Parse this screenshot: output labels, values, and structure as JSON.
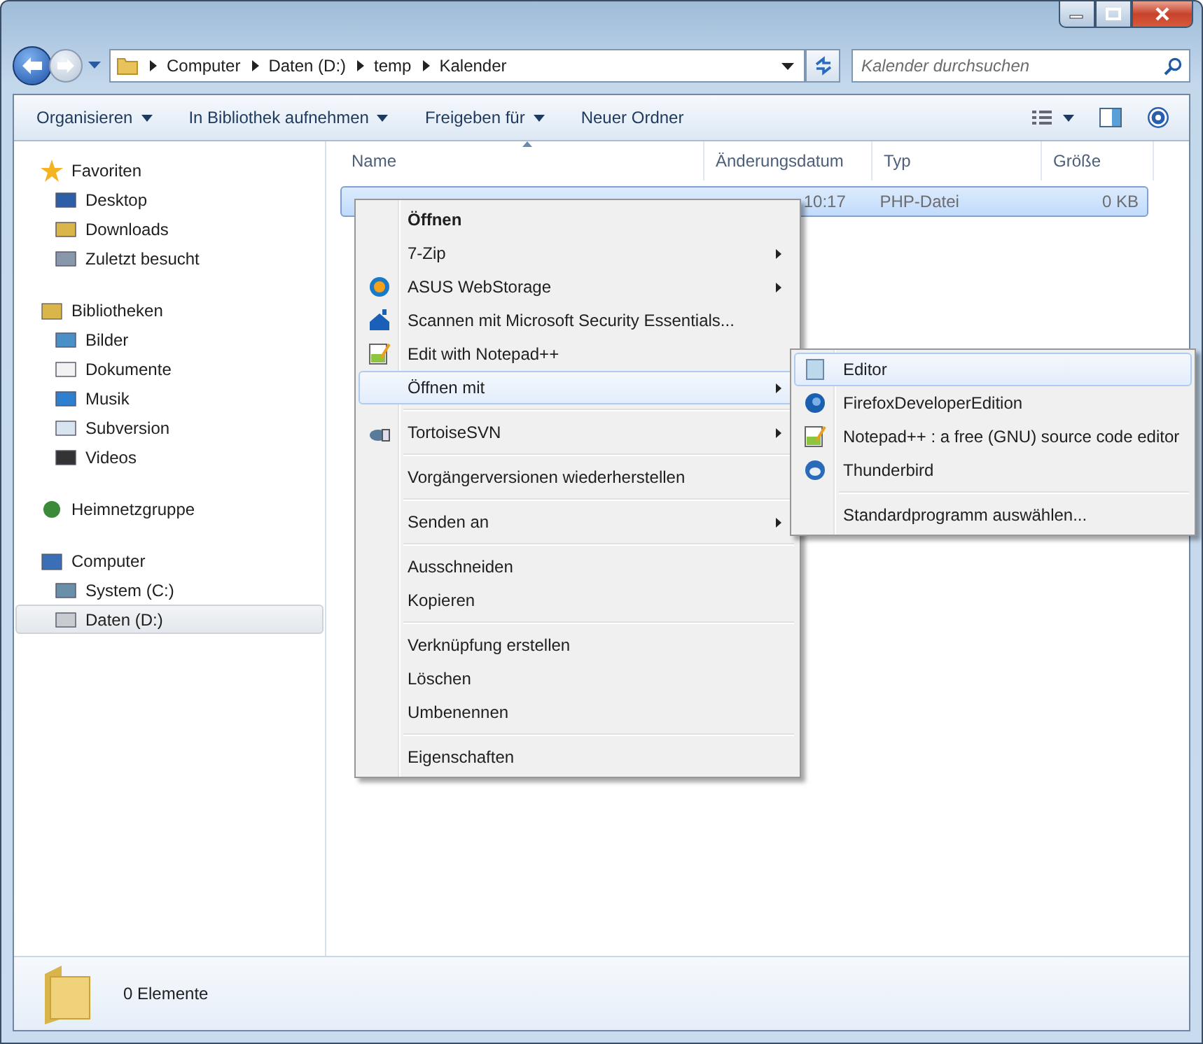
{
  "address_bar": {
    "path": [
      "Computer",
      "Daten (D:)",
      "temp",
      "Kalender"
    ]
  },
  "search": {
    "placeholder": "Kalender durchsuchen"
  },
  "toolbar": [
    {
      "label": "Organisieren",
      "has_menu": true
    },
    {
      "label": "In Bibliothek aufnehmen",
      "has_menu": true
    },
    {
      "label": "Freigeben für",
      "has_menu": true
    },
    {
      "label": "Neuer Ordner",
      "has_menu": false
    }
  ],
  "sidebar": [
    {
      "label": "Favoriten",
      "children": [
        {
          "label": "Desktop",
          "selected": false
        },
        {
          "label": "Downloads",
          "selected": false
        },
        {
          "label": "Zuletzt besucht",
          "selected": false
        }
      ]
    },
    {
      "label": "Bibliotheken",
      "children": [
        {
          "label": "Bilder",
          "selected": false
        },
        {
          "label": "Dokumente",
          "selected": false
        },
        {
          "label": "Musik",
          "selected": false
        },
        {
          "label": "Subversion",
          "selected": false
        },
        {
          "label": "Videos",
          "selected": false
        }
      ]
    },
    {
      "label": "Heimnetzgruppe"
    },
    {
      "label": "Computer",
      "children": [
        {
          "label": "System (C:)",
          "selected": false
        },
        {
          "label": "Daten (D:)",
          "selected": true
        }
      ]
    }
  ],
  "columns": [
    {
      "label": "Name",
      "sorted": true
    },
    {
      "label": "Änderungsdatum",
      "sorted": false
    },
    {
      "label": "Typ",
      "sorted": false
    },
    {
      "label": "Größe",
      "sorted": false
    }
  ],
  "rows": [
    {
      "date": "10:17",
      "type": "PHP-Datei",
      "size": "0 KB",
      "selected": true
    }
  ],
  "context_menu": [
    {
      "kind": "item",
      "label": "Öffnen",
      "default": true,
      "submenu": false,
      "selected": false
    },
    {
      "kind": "item",
      "label": "7-Zip",
      "default": false,
      "submenu": true,
      "selected": false
    },
    {
      "kind": "item",
      "label": "ASUS WebStorage",
      "default": false,
      "submenu": true,
      "selected": false
    },
    {
      "kind": "item",
      "label": "Scannen mit Microsoft Security Essentials...",
      "default": false,
      "submenu": false,
      "selected": false
    },
    {
      "kind": "item",
      "label": "Edit with Notepad++",
      "default": false,
      "submenu": false,
      "selected": false
    },
    {
      "kind": "item",
      "label": "Öffnen mit",
      "default": false,
      "submenu": true,
      "selected": true
    },
    {
      "kind": "separator"
    },
    {
      "kind": "item",
      "label": "TortoiseSVN",
      "default": false,
      "submenu": true,
      "selected": false
    },
    {
      "kind": "separator"
    },
    {
      "kind": "item",
      "label": "Vorgängerversionen wiederherstellen",
      "default": false,
      "submenu": false,
      "selected": false
    },
    {
      "kind": "separator"
    },
    {
      "kind": "item",
      "label": "Senden an",
      "default": false,
      "submenu": true,
      "selected": false
    },
    {
      "kind": "separator"
    },
    {
      "kind": "item",
      "label": "Ausschneiden",
      "default": false,
      "submenu": false,
      "selected": false
    },
    {
      "kind": "item",
      "label": "Kopieren",
      "default": false,
      "submenu": false,
      "selected": false
    },
    {
      "kind": "separator"
    },
    {
      "kind": "item",
      "label": "Verknüpfung erstellen",
      "default": false,
      "submenu": false,
      "selected": false
    },
    {
      "kind": "item",
      "label": "Löschen",
      "default": false,
      "submenu": false,
      "selected": false
    },
    {
      "kind": "item",
      "label": "Umbenennen",
      "default": false,
      "submenu": false,
      "selected": false
    },
    {
      "kind": "separator"
    },
    {
      "kind": "item",
      "label": "Eigenschaften",
      "default": false,
      "submenu": false,
      "selected": false
    }
  ],
  "open_with_menu": [
    {
      "kind": "item",
      "label": "Editor",
      "selected": true
    },
    {
      "kind": "item",
      "label": "FirefoxDeveloperEdition",
      "selected": false
    },
    {
      "kind": "item",
      "label": "Notepad++ : a free (GNU) source code editor",
      "selected": false
    },
    {
      "kind": "item",
      "label": "Thunderbird",
      "selected": false
    },
    {
      "kind": "separator"
    },
    {
      "kind": "item",
      "label": "Standardprogramm auswählen...",
      "selected": false
    }
  ],
  "status_bar": {
    "count": "0 Elemente"
  }
}
